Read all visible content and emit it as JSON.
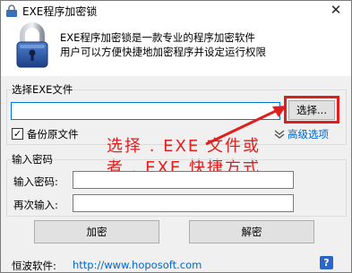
{
  "window": {
    "title": "EXE程序加密锁",
    "close_glyph": "✕"
  },
  "header": {
    "line1": "EXE程序加密锁是一款专业的程序加密软件",
    "line2": "用户可以方便快捷地加密程序并设定运行权限"
  },
  "select_group": {
    "title": "选择EXE文件",
    "path_value": "",
    "browse_label": "选择...",
    "backup_label": "备份原文件",
    "backup_checked_glyph": "✓",
    "advanced_label": "高级选项"
  },
  "annotation": {
    "line1": "选择 . EXE 文件或",
    "line2": "者 . EXE 快捷方式",
    "color": "#e01e1e"
  },
  "password_group": {
    "title": "输入密码",
    "password_label": "输入密码:",
    "password_value": "",
    "confirm_label": "再次输入:",
    "confirm_value": ""
  },
  "actions": {
    "encrypt_label": "加密",
    "decrypt_label": "解密"
  },
  "footer": {
    "company": "恒波软件:",
    "link": "http://www.hoposoft.com",
    "help_glyph": "?"
  }
}
